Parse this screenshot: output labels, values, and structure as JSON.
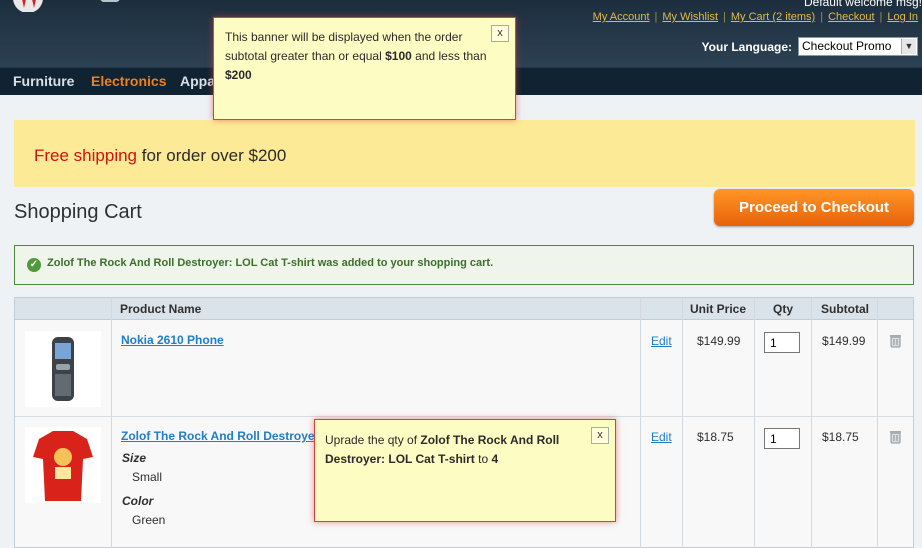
{
  "header": {
    "welcome": "Default welcome msg!",
    "links": [
      "My Account",
      "My Wishlist",
      "My Cart (2 items)",
      "Checkout",
      "Log In"
    ],
    "language_label": "Your Language:",
    "language_value": "Checkout Promo"
  },
  "nav": {
    "items": [
      "Furniture",
      "Electronics",
      "Appa"
    ]
  },
  "banner": {
    "highlight": "Free shipping",
    "text": " for order over $200"
  },
  "page": {
    "title": "Shopping Cart",
    "checkout_button": "Proceed to Checkout"
  },
  "success_message": "Zolof The Rock And Roll Destroyer: LOL Cat T-shirt was added to your shopping cart.",
  "table": {
    "headers": {
      "product": "Product Name",
      "unit_price": "Unit Price",
      "qty": "Qty",
      "subtotal": "Subtotal"
    },
    "rows": [
      {
        "name": "Nokia 2610 Phone",
        "edit": "Edit",
        "unit_price": "$149.99",
        "qty": "1",
        "subtotal": "$149.99"
      },
      {
        "name": "Zolof The Rock And Roll Destroyer",
        "edit": "Edit",
        "unit_price": "$18.75",
        "qty": "1",
        "subtotal": "$18.75",
        "options": [
          {
            "label": "Size",
            "value": "Small"
          },
          {
            "label": "Color",
            "value": "Green"
          }
        ]
      }
    ]
  },
  "tooltip_banner": {
    "close": "x",
    "text_1": "This banner will be displayed when the order subtotal greater than or equal ",
    "bold_1": "$100",
    "text_2": " and less than ",
    "bold_2": "$200"
  },
  "tooltip_qty": {
    "close": "x",
    "text_1": "Uprade the qty of ",
    "bold_1": "Zolof The Rock And Roll Destroyer: LOL Cat T-shirt",
    "text_2": " to ",
    "bold_2": "4"
  },
  "colors": {
    "accent_orange": "#ff9626",
    "link_blue": "#1e7ec8",
    "header_dark": "#1c2e3e",
    "banner_yellow": "#fcea96",
    "tooltip_yellow": "#fdfcc3",
    "free_shipping_red": "#d3120d"
  }
}
